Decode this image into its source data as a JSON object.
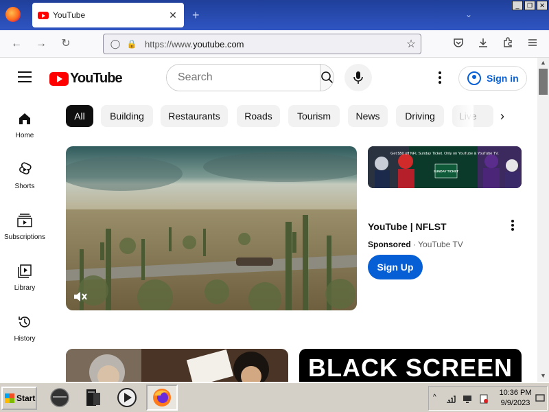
{
  "browser": {
    "tab_title": "YouTube",
    "tab_close": "✕",
    "new_tab": "+",
    "url_prefix": "https://www.",
    "url_host": "youtube.com",
    "window_buttons": [
      "_",
      "❐",
      "✕"
    ]
  },
  "youtube": {
    "logo_text": "YouTube",
    "search_placeholder": "Search",
    "sign_in_label": "Sign in",
    "sidebar": [
      {
        "label": "Home",
        "icon": "home-icon"
      },
      {
        "label": "Shorts",
        "icon": "shorts-icon"
      },
      {
        "label": "Subscriptions",
        "icon": "subscriptions-icon"
      },
      {
        "label": "Library",
        "icon": "library-icon"
      },
      {
        "label": "History",
        "icon": "history-icon"
      }
    ],
    "chips": [
      "All",
      "Building",
      "Restaurants",
      "Roads",
      "Tourism",
      "News",
      "Driving",
      "Live"
    ],
    "chip_next": "›",
    "ad": {
      "title": "YouTube | NFLST",
      "sponsored": "Sponsored",
      "separator": "·",
      "advertiser": "YouTube TV",
      "cta": "Sign Up",
      "banner_text": "Get $50 off NFL Sunday Ticket. Only on YouTube & YouTube TV.",
      "banner_badge": "SUNDAY TICKET"
    },
    "next_video_title": "BLACK SCREEN"
  },
  "taskbar": {
    "start_label": "Start",
    "clock_time": "10:36 PM",
    "clock_date": "9/9/2023",
    "tray_expand": "^"
  },
  "colors": {
    "brand_red": "#ff0000",
    "link_blue": "#065fd4",
    "chip_active": "#0f0f0f",
    "chip_bg": "#f2f2f2"
  }
}
